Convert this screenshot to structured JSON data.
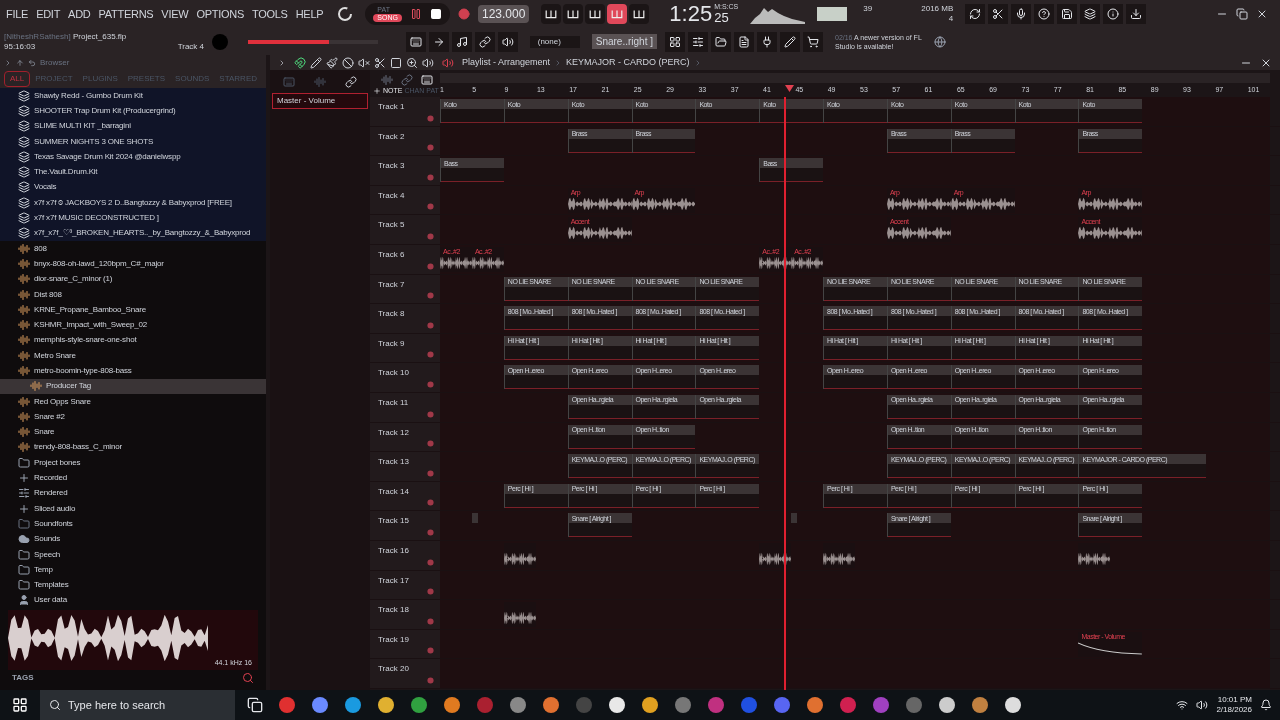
{
  "menu": [
    "FILE",
    "EDIT",
    "ADD",
    "PATTERNS",
    "VIEW",
    "OPTIONS",
    "TOOLS",
    "HELP"
  ],
  "mode": [
    {
      "label": "PAT",
      "selected": false
    },
    {
      "label": "SONG",
      "selected": true
    }
  ],
  "transport": {
    "playing": true,
    "recording": false
  },
  "tempo": "123.000",
  "time": {
    "value": "1:25",
    "sub": "25",
    "unit": "M:S:CS"
  },
  "meters": {
    "cpu": "39",
    "memory": "2016 MB",
    "voices": "4"
  },
  "toggles": [
    {
      "on": false
    },
    {
      "on": false
    },
    {
      "on": false
    },
    {
      "on": true
    },
    {
      "on": false
    }
  ],
  "project": {
    "user": "[NitheshRSathesh]",
    "file": "Project_635.flp",
    "elapsed": "95:16:03",
    "track": "Track 4"
  },
  "master_volume": {
    "level": 0.62
  },
  "pattern": "(none)",
  "preset": "Snare..right ]",
  "news": {
    "date": "02/16",
    "text": "A newer version of FL Studio is available!"
  },
  "browser": {
    "title": "Browser",
    "tabs": [
      {
        "label": "ALL",
        "selected": true
      },
      {
        "label": "PROJECT",
        "selected": false
      },
      {
        "label": "PLUGINS",
        "selected": false
      },
      {
        "label": "PRESETS",
        "selected": false
      },
      {
        "label": "SOUNDS",
        "selected": false
      },
      {
        "label": "STARRED",
        "selected": false
      }
    ],
    "items": [
      {
        "kind": "pack",
        "label": "Shawty Redd - Gumbo Drum Kit",
        "selected": false
      },
      {
        "kind": "pack",
        "label": "SHOOTER Trap Drum Kit (Producergrind)",
        "selected": false
      },
      {
        "kind": "pack",
        "label": "SLIME MULTI KIT _barragini",
        "selected": false
      },
      {
        "kind": "pack",
        "label": "SUMMER NIGHTS 3 ONE SHOTS",
        "selected": false
      },
      {
        "kind": "pack",
        "label": "Texas Savage Drum Kit 2024 @danielwspp",
        "selected": false
      },
      {
        "kind": "pack",
        "label": "The.Vault.Drum.Kit",
        "selected": false
      },
      {
        "kind": "pack",
        "label": "Vocals",
        "selected": false
      },
      {
        "kind": "pack",
        "label": "x7f x7f ⦸ JACKBOYS 2 D..Bangtozzy & Babyxprod [FREE]",
        "selected": false
      },
      {
        "kind": "pack",
        "label": "x7f x7f MUSIC DECONSTRUCTED ]",
        "selected": false
      },
      {
        "kind": "pack",
        "label": "x7f_x7f_♡³_BROKEN_HEARTS.._by_Bangtozzy_&_Babyxprod",
        "selected": false
      },
      {
        "kind": "sample",
        "label": "808",
        "selected": false
      },
      {
        "kind": "sample",
        "label": "bnyx-808-oh-lawd_120bpm_C#_major",
        "selected": false
      },
      {
        "kind": "sample",
        "label": "dior-snare_C_minor (1)",
        "selected": false
      },
      {
        "kind": "sample",
        "label": "Dist 808",
        "selected": false
      },
      {
        "kind": "sample",
        "label": "KRNE_Propane_Bamboo_Snare",
        "selected": false
      },
      {
        "kind": "sample",
        "label": "KSHMR_Impact_with_Sweep_02",
        "selected": false
      },
      {
        "kind": "sample",
        "label": "memphis-style-snare-one-shot",
        "selected": false
      },
      {
        "kind": "sample",
        "label": "Metro Snare",
        "selected": false
      },
      {
        "kind": "sample",
        "label": "metro-boomin-type-808-bass",
        "selected": false
      },
      {
        "kind": "sample",
        "label": "Producer Tag",
        "selected": true
      },
      {
        "kind": "sample",
        "label": "Red Opps Snare",
        "selected": false
      },
      {
        "kind": "sample",
        "label": "Snare #2",
        "selected": false
      },
      {
        "kind": "sample",
        "label": "Snare",
        "selected": false
      },
      {
        "kind": "sample",
        "label": "trendy-808-bass_C_minor",
        "selected": false
      },
      {
        "kind": "folder",
        "label": "Project bones",
        "selected": false
      },
      {
        "kind": "audio",
        "label": "Recorded",
        "selected": false
      },
      {
        "kind": "rendered",
        "label": "Rendered",
        "selected": false
      },
      {
        "kind": "audio",
        "label": "Sliced audio",
        "selected": false
      },
      {
        "kind": "plain",
        "label": "Soundfonts",
        "selected": false
      },
      {
        "kind": "cloud",
        "label": "Sounds",
        "selected": false
      },
      {
        "kind": "folder",
        "label": "Speech",
        "selected": false
      },
      {
        "kind": "folder",
        "label": "Temp",
        "selected": false
      },
      {
        "kind": "folder",
        "label": "Templates",
        "selected": false
      },
      {
        "kind": "user",
        "label": "User data",
        "selected": false
      }
    ],
    "preview_info": "44.1 kHz 16",
    "tags": "TAGS"
  },
  "playlist": {
    "title": "Playlist - Arrangement",
    "pattern": "KEYMAJOR - CARDO (PERC)",
    "picker_labels": [
      "NOTE",
      "CHAN",
      "PAT"
    ],
    "picker_item": {
      "label": "Master - Volume",
      "selected": true
    },
    "ruler": [
      "1",
      "5",
      "9",
      "13",
      "17",
      "21",
      "25",
      "29",
      "33",
      "37",
      "41",
      "45",
      "49",
      "53",
      "57",
      "61",
      "65",
      "69",
      "73",
      "77",
      "81",
      "85",
      "89",
      "93",
      "97",
      "101"
    ],
    "playhead": {
      "level": 0.415
    },
    "tracks": [
      {
        "name": "Track 1",
        "lane": [
          {
            "kind": "pattern",
            "label": "Koto"
          },
          {
            "kind": "hold"
          },
          {
            "kind": "pattern",
            "label": "Koto"
          },
          {
            "kind": "hold"
          },
          {
            "kind": "pattern",
            "label": "Koto"
          },
          {
            "kind": "hold"
          },
          {
            "kind": "pattern",
            "label": "Koto"
          },
          {
            "kind": "hold"
          },
          {
            "kind": "pattern",
            "label": "Koto"
          },
          {
            "kind": "hold"
          },
          {
            "kind": "pattern",
            "label": "Koto"
          },
          {
            "kind": "hold"
          },
          {
            "kind": "pattern",
            "label": "Koto"
          },
          {
            "kind": "hold"
          },
          {
            "kind": "pattern",
            "label": "Koto"
          },
          {
            "kind": "hold"
          },
          {
            "kind": "pattern",
            "label": "Koto"
          },
          {
            "kind": "hold"
          },
          {
            "kind": "pattern",
            "label": "Koto"
          },
          {
            "kind": "hold"
          },
          {
            "kind": "pattern",
            "label": "Koto"
          },
          {
            "kind": "hold"
          }
        ]
      },
      {
        "name": "Track 2",
        "lane": [
          {
            "kind": "rest"
          },
          {
            "kind": "rest"
          },
          {
            "kind": "rest"
          },
          {
            "kind": "rest"
          },
          {
            "kind": "pattern",
            "label": "Brass"
          },
          {
            "kind": "hold"
          },
          {
            "kind": "pattern",
            "label": "Brass"
          },
          {
            "kind": "hold"
          },
          {
            "kind": "rest"
          },
          {
            "kind": "rest"
          },
          {
            "kind": "rest"
          },
          {
            "kind": "rest"
          },
          {
            "kind": "rest"
          },
          {
            "kind": "rest"
          },
          {
            "kind": "pattern",
            "label": "Brass"
          },
          {
            "kind": "hold"
          },
          {
            "kind": "pattern",
            "label": "Brass"
          },
          {
            "kind": "hold"
          },
          {
            "kind": "rest"
          },
          {
            "kind": "rest"
          },
          {
            "kind": "pattern",
            "label": "Brass"
          },
          {
            "kind": "hold"
          }
        ]
      },
      {
        "name": "Track 3",
        "lane": [
          {
            "kind": "pattern",
            "label": "Bass"
          },
          {
            "kind": "hold"
          },
          {
            "kind": "rest"
          },
          {
            "kind": "rest"
          },
          {
            "kind": "rest"
          },
          {
            "kind": "rest"
          },
          {
            "kind": "rest"
          },
          {
            "kind": "rest"
          },
          {
            "kind": "rest"
          },
          {
            "kind": "rest"
          },
          {
            "kind": "pattern",
            "label": "Bass"
          },
          {
            "kind": "hold"
          }
        ]
      },
      {
        "name": "Track 4",
        "lane": [
          {
            "kind": "rest"
          },
          {
            "kind": "rest"
          },
          {
            "kind": "rest"
          },
          {
            "kind": "rest"
          },
          {
            "kind": "audio",
            "label": "Arp"
          },
          {
            "kind": "hold"
          },
          {
            "kind": "audio",
            "label": "Arp"
          },
          {
            "kind": "hold"
          },
          {
            "kind": "rest"
          },
          {
            "kind": "rest"
          },
          {
            "kind": "rest"
          },
          {
            "kind": "rest"
          },
          {
            "kind": "rest"
          },
          {
            "kind": "rest"
          },
          {
            "kind": "audio",
            "label": "Arp"
          },
          {
            "kind": "hold"
          },
          {
            "kind": "audio",
            "label": "Arp"
          },
          {
            "kind": "hold"
          },
          {
            "kind": "rest"
          },
          {
            "kind": "rest"
          },
          {
            "kind": "audio",
            "label": "Arp"
          },
          {
            "kind": "hold"
          }
        ]
      },
      {
        "name": "Track 5",
        "lane": [
          {
            "kind": "rest"
          },
          {
            "kind": "rest"
          },
          {
            "kind": "rest"
          },
          {
            "kind": "rest"
          },
          {
            "kind": "audio",
            "label": "Accent"
          },
          {
            "kind": "hold"
          },
          {
            "kind": "rest"
          },
          {
            "kind": "rest"
          },
          {
            "kind": "rest"
          },
          {
            "kind": "rest"
          },
          {
            "kind": "rest"
          },
          {
            "kind": "rest"
          },
          {
            "kind": "rest"
          },
          {
            "kind": "rest"
          },
          {
            "kind": "audio",
            "label": "Accent"
          },
          {
            "kind": "hold"
          },
          {
            "kind": "rest"
          },
          {
            "kind": "rest"
          },
          {
            "kind": "rest"
          },
          {
            "kind": "rest"
          },
          {
            "kind": "audio",
            "label": "Accent"
          },
          {
            "kind": "hold"
          }
        ]
      },
      {
        "name": "Track 6",
        "lane": [
          {
            "kind": "audio",
            "label": "Ac..#2"
          },
          {
            "kind": "audio",
            "label": "Ac..#2"
          },
          {
            "kind": "rest"
          },
          {
            "kind": "rest"
          },
          {
            "kind": "rest"
          },
          {
            "kind": "rest"
          },
          {
            "kind": "rest"
          },
          {
            "kind": "rest"
          },
          {
            "kind": "rest"
          },
          {
            "kind": "rest"
          },
          {
            "kind": "audio",
            "label": "Ac..#2"
          },
          {
            "kind": "audio",
            "label": "Ac..#2"
          }
        ]
      },
      {
        "name": "Track 7",
        "lane": [
          {
            "kind": "rest"
          },
          {
            "kind": "rest"
          },
          {
            "kind": "pattern",
            "label": "NO LIE SNARE"
          },
          {
            "kind": "hold"
          },
          {
            "kind": "pattern",
            "label": "NO LIE SNARE"
          },
          {
            "kind": "hold"
          },
          {
            "kind": "pattern",
            "label": "NO LIE SNARE"
          },
          {
            "kind": "hold"
          },
          {
            "kind": "pattern",
            "label": "NO LIE SNARE"
          },
          {
            "kind": "hold"
          },
          {
            "kind": "rest"
          },
          {
            "kind": "rest"
          },
          {
            "kind": "pattern",
            "label": "NO LIE SNARE"
          },
          {
            "kind": "hold"
          },
          {
            "kind": "pattern",
            "label": "NO LIE SNARE"
          },
          {
            "kind": "hold"
          },
          {
            "kind": "pattern",
            "label": "NO LIE SNARE"
          },
          {
            "kind": "hold"
          },
          {
            "kind": "pattern",
            "label": "NO LIE SNARE"
          },
          {
            "kind": "hold"
          },
          {
            "kind": "pattern",
            "label": "NO LIE SNARE"
          },
          {
            "kind": "hold"
          }
        ]
      },
      {
        "name": "Track 8",
        "lane": [
          {
            "kind": "rest"
          },
          {
            "kind": "rest"
          },
          {
            "kind": "pattern",
            "label": "808 [ Mo..Hated ]"
          },
          {
            "kind": "hold"
          },
          {
            "kind": "pattern",
            "label": "808 [ Mo..Hated ]"
          },
          {
            "kind": "hold"
          },
          {
            "kind": "pattern",
            "label": "808 [ Mo..Hated ]"
          },
          {
            "kind": "hold"
          },
          {
            "kind": "pattern",
            "label": "808 [ Mo..Hated ]"
          },
          {
            "kind": "hold"
          },
          {
            "kind": "rest"
          },
          {
            "kind": "rest"
          },
          {
            "kind": "pattern",
            "label": "808 [ Mo..Hated ]"
          },
          {
            "kind": "hold"
          },
          {
            "kind": "pattern",
            "label": "808 [ Mo..Hated ]"
          },
          {
            "kind": "hold"
          },
          {
            "kind": "pattern",
            "label": "808 [ Mo..Hated ]"
          },
          {
            "kind": "hold"
          },
          {
            "kind": "pattern",
            "label": "808 [ Mo..Hated ]"
          },
          {
            "kind": "hold"
          },
          {
            "kind": "pattern",
            "label": "808 [ Mo..Hated ]"
          },
          {
            "kind": "hold"
          }
        ]
      },
      {
        "name": "Track 9",
        "lane": [
          {
            "kind": "rest"
          },
          {
            "kind": "rest"
          },
          {
            "kind": "pattern",
            "label": "Hi Hat [ Hit ]"
          },
          {
            "kind": "hold"
          },
          {
            "kind": "pattern",
            "label": "Hi Hat [ Hit ]"
          },
          {
            "kind": "hold"
          },
          {
            "kind": "pattern",
            "label": "Hi Hat [ Hit ]"
          },
          {
            "kind": "hold"
          },
          {
            "kind": "pattern",
            "label": "Hi Hat [ Hit ]"
          },
          {
            "kind": "hold"
          },
          {
            "kind": "rest"
          },
          {
            "kind": "rest"
          },
          {
            "kind": "pattern",
            "label": "Hi Hat [ Hit ]"
          },
          {
            "kind": "hold"
          },
          {
            "kind": "pattern",
            "label": "Hi Hat [ Hit ]"
          },
          {
            "kind": "hold"
          },
          {
            "kind": "pattern",
            "label": "Hi Hat [ Hit ]"
          },
          {
            "kind": "hold"
          },
          {
            "kind": "pattern",
            "label": "Hi Hat [ Hit ]"
          },
          {
            "kind": "hold"
          },
          {
            "kind": "pattern",
            "label": "Hi Hat [ Hit ]"
          },
          {
            "kind": "hold"
          }
        ]
      },
      {
        "name": "Track 10",
        "lane": [
          {
            "kind": "rest"
          },
          {
            "kind": "rest"
          },
          {
            "kind": "pattern",
            "label": "Open H..ereo"
          },
          {
            "kind": "hold"
          },
          {
            "kind": "pattern",
            "label": "Open H..ereo"
          },
          {
            "kind": "hold"
          },
          {
            "kind": "pattern",
            "label": "Open H..ereo"
          },
          {
            "kind": "hold"
          },
          {
            "kind": "pattern",
            "label": "Open H..ereo"
          },
          {
            "kind": "hold"
          },
          {
            "kind": "rest"
          },
          {
            "kind": "rest"
          },
          {
            "kind": "pattern",
            "label": "Open H..ereo"
          },
          {
            "kind": "hold"
          },
          {
            "kind": "pattern",
            "label": "Open H..ereo"
          },
          {
            "kind": "hold"
          },
          {
            "kind": "pattern",
            "label": "Open H..ereo"
          },
          {
            "kind": "hold"
          },
          {
            "kind": "pattern",
            "label": "Open H..ereo"
          },
          {
            "kind": "hold"
          },
          {
            "kind": "pattern",
            "label": "Open H..ereo"
          },
          {
            "kind": "hold"
          }
        ]
      },
      {
        "name": "Track 11",
        "lane": [
          {
            "kind": "rest"
          },
          {
            "kind": "rest"
          },
          {
            "kind": "rest"
          },
          {
            "kind": "rest"
          },
          {
            "kind": "pattern",
            "label": "Open Ha..rgiela"
          },
          {
            "kind": "hold"
          },
          {
            "kind": "pattern",
            "label": "Open Ha..rgiela"
          },
          {
            "kind": "hold"
          },
          {
            "kind": "pattern",
            "label": "Open Ha..rgiela"
          },
          {
            "kind": "hold"
          },
          {
            "kind": "rest"
          },
          {
            "kind": "rest"
          },
          {
            "kind": "rest"
          },
          {
            "kind": "rest"
          },
          {
            "kind": "pattern",
            "label": "Open Ha..rgiela"
          },
          {
            "kind": "hold"
          },
          {
            "kind": "pattern",
            "label": "Open Ha..rgiela"
          },
          {
            "kind": "hold"
          },
          {
            "kind": "pattern",
            "label": "Open Ha..rgiela"
          },
          {
            "kind": "hold"
          },
          {
            "kind": "pattern",
            "label": "Open Ha..rgiela"
          },
          {
            "kind": "hold"
          }
        ]
      },
      {
        "name": "Track 12",
        "lane": [
          {
            "kind": "rest"
          },
          {
            "kind": "rest"
          },
          {
            "kind": "rest"
          },
          {
            "kind": "rest"
          },
          {
            "kind": "pattern",
            "label": "Open H..tion"
          },
          {
            "kind": "hold"
          },
          {
            "kind": "pattern",
            "label": "Open H..tion"
          },
          {
            "kind": "hold"
          },
          {
            "kind": "rest"
          },
          {
            "kind": "rest"
          },
          {
            "kind": "rest"
          },
          {
            "kind": "rest"
          },
          {
            "kind": "rest"
          },
          {
            "kind": "rest"
          },
          {
            "kind": "pattern",
            "label": "Open H..tion"
          },
          {
            "kind": "hold"
          },
          {
            "kind": "pattern",
            "label": "Open H..tion"
          },
          {
            "kind": "hold"
          },
          {
            "kind": "pattern",
            "label": "Open H..tion"
          },
          {
            "kind": "hold"
          },
          {
            "kind": "pattern",
            "label": "Open H..tion"
          },
          {
            "kind": "hold"
          }
        ]
      },
      {
        "name": "Track 13",
        "lane": [
          {
            "kind": "rest"
          },
          {
            "kind": "rest"
          },
          {
            "kind": "rest"
          },
          {
            "kind": "rest"
          },
          {
            "kind": "pattern",
            "label": "KEYMAJ..O (PERC)"
          },
          {
            "kind": "hold"
          },
          {
            "kind": "pattern",
            "label": "KEYMAJ..O (PERC)"
          },
          {
            "kind": "hold"
          },
          {
            "kind": "pattern",
            "label": "KEYMAJ..O (PERC)"
          },
          {
            "kind": "hold"
          },
          {
            "kind": "rest"
          },
          {
            "kind": "rest"
          },
          {
            "kind": "rest"
          },
          {
            "kind": "rest"
          },
          {
            "kind": "pattern",
            "label": "KEYMAJ..O (PERC)"
          },
          {
            "kind": "hold"
          },
          {
            "kind": "pattern",
            "label": "KEYMAJ..O (PERC)"
          },
          {
            "kind": "hold"
          },
          {
            "kind": "pattern",
            "label": "KEYMAJ..O (PERC)"
          },
          {
            "kind": "hold"
          },
          {
            "kind": "pattern",
            "label": "KEYMAJOR - CARDO (PERC)"
          },
          {
            "kind": "hold"
          },
          {
            "kind": "hold"
          },
          {
            "kind": "hold"
          }
        ]
      },
      {
        "name": "Track 14",
        "lane": [
          {
            "kind": "rest"
          },
          {
            "kind": "rest"
          },
          {
            "kind": "pattern",
            "label": "Perc [ Hi ]"
          },
          {
            "kind": "hold"
          },
          {
            "kind": "pattern",
            "label": "Perc [ Hi ]"
          },
          {
            "kind": "hold"
          },
          {
            "kind": "pattern",
            "label": "Perc [ Hi ]"
          },
          {
            "kind": "hold"
          },
          {
            "kind": "pattern",
            "label": "Perc [ Hi ]"
          },
          {
            "kind": "hold"
          },
          {
            "kind": "rest"
          },
          {
            "kind": "rest"
          },
          {
            "kind": "pattern",
            "label": "Perc [ Hi ]"
          },
          {
            "kind": "hold"
          },
          {
            "kind": "pattern",
            "label": "Perc [ Hi ]"
          },
          {
            "kind": "hold"
          },
          {
            "kind": "pattern",
            "label": "Perc [ Hi ]"
          },
          {
            "kind": "hold"
          },
          {
            "kind": "pattern",
            "label": "Perc [ Hi ]"
          },
          {
            "kind": "hold"
          },
          {
            "kind": "pattern",
            "label": "Perc [ Hi ]"
          },
          {
            "kind": "hold"
          }
        ]
      },
      {
        "name": "Track 15",
        "lane": [
          {
            "kind": "rest"
          },
          {
            "kind": "marker"
          },
          {
            "kind": "rest"
          },
          {
            "kind": "rest"
          },
          {
            "kind": "pattern",
            "label": "Snare [ Alright ]"
          },
          {
            "kind": "hold"
          },
          {
            "kind": "rest"
          },
          {
            "kind": "rest"
          },
          {
            "kind": "rest"
          },
          {
            "kind": "rest"
          },
          {
            "kind": "rest"
          },
          {
            "kind": "marker"
          },
          {
            "kind": "rest"
          },
          {
            "kind": "rest"
          },
          {
            "kind": "pattern",
            "label": "Snare [ Alright ]"
          },
          {
            "kind": "hold"
          },
          {
            "kind": "rest"
          },
          {
            "kind": "rest"
          },
          {
            "kind": "rest"
          },
          {
            "kind": "rest"
          },
          {
            "kind": "pattern",
            "label": "Snare [ Alright ]"
          },
          {
            "kind": "hold"
          }
        ]
      },
      {
        "name": "Track 16",
        "lane": [
          {
            "kind": "rest"
          },
          {
            "kind": "rest"
          },
          {
            "kind": "audio"
          },
          {
            "kind": "rest"
          },
          {
            "kind": "rest"
          },
          {
            "kind": "rest"
          },
          {
            "kind": "rest"
          },
          {
            "kind": "rest"
          },
          {
            "kind": "rest"
          },
          {
            "kind": "rest"
          },
          {
            "kind": "audio"
          },
          {
            "kind": "rest"
          },
          {
            "kind": "audio"
          },
          {
            "kind": "rest"
          },
          {
            "kind": "rest"
          },
          {
            "kind": "rest"
          },
          {
            "kind": "rest"
          },
          {
            "kind": "rest"
          },
          {
            "kind": "rest"
          },
          {
            "kind": "rest"
          },
          {
            "kind": "audio"
          }
        ]
      },
      {
        "name": "Track 17"
      },
      {
        "name": "Track 18",
        "lane": [
          {
            "kind": "rest"
          },
          {
            "kind": "rest"
          },
          {
            "kind": "audio"
          }
        ]
      },
      {
        "name": "Track 19",
        "lane": [
          {
            "kind": "rest"
          },
          {
            "kind": "rest"
          },
          {
            "kind": "rest"
          },
          {
            "kind": "rest"
          },
          {
            "kind": "rest"
          },
          {
            "kind": "rest"
          },
          {
            "kind": "rest"
          },
          {
            "kind": "rest"
          },
          {
            "kind": "rest"
          },
          {
            "kind": "rest"
          },
          {
            "kind": "rest"
          },
          {
            "kind": "rest"
          },
          {
            "kind": "rest"
          },
          {
            "kind": "rest"
          },
          {
            "kind": "rest"
          },
          {
            "kind": "rest"
          },
          {
            "kind": "rest"
          },
          {
            "kind": "rest"
          },
          {
            "kind": "rest"
          },
          {
            "kind": "rest"
          },
          {
            "kind": "automation",
            "label": "Master - Volume"
          },
          {
            "kind": "hold"
          }
        ]
      },
      {
        "name": "Track 20"
      }
    ]
  },
  "taskbar": {
    "search": {
      "placeholder": "Type here to search"
    },
    "time": "10:01 PM",
    "date": "2/18/2026"
  }
}
